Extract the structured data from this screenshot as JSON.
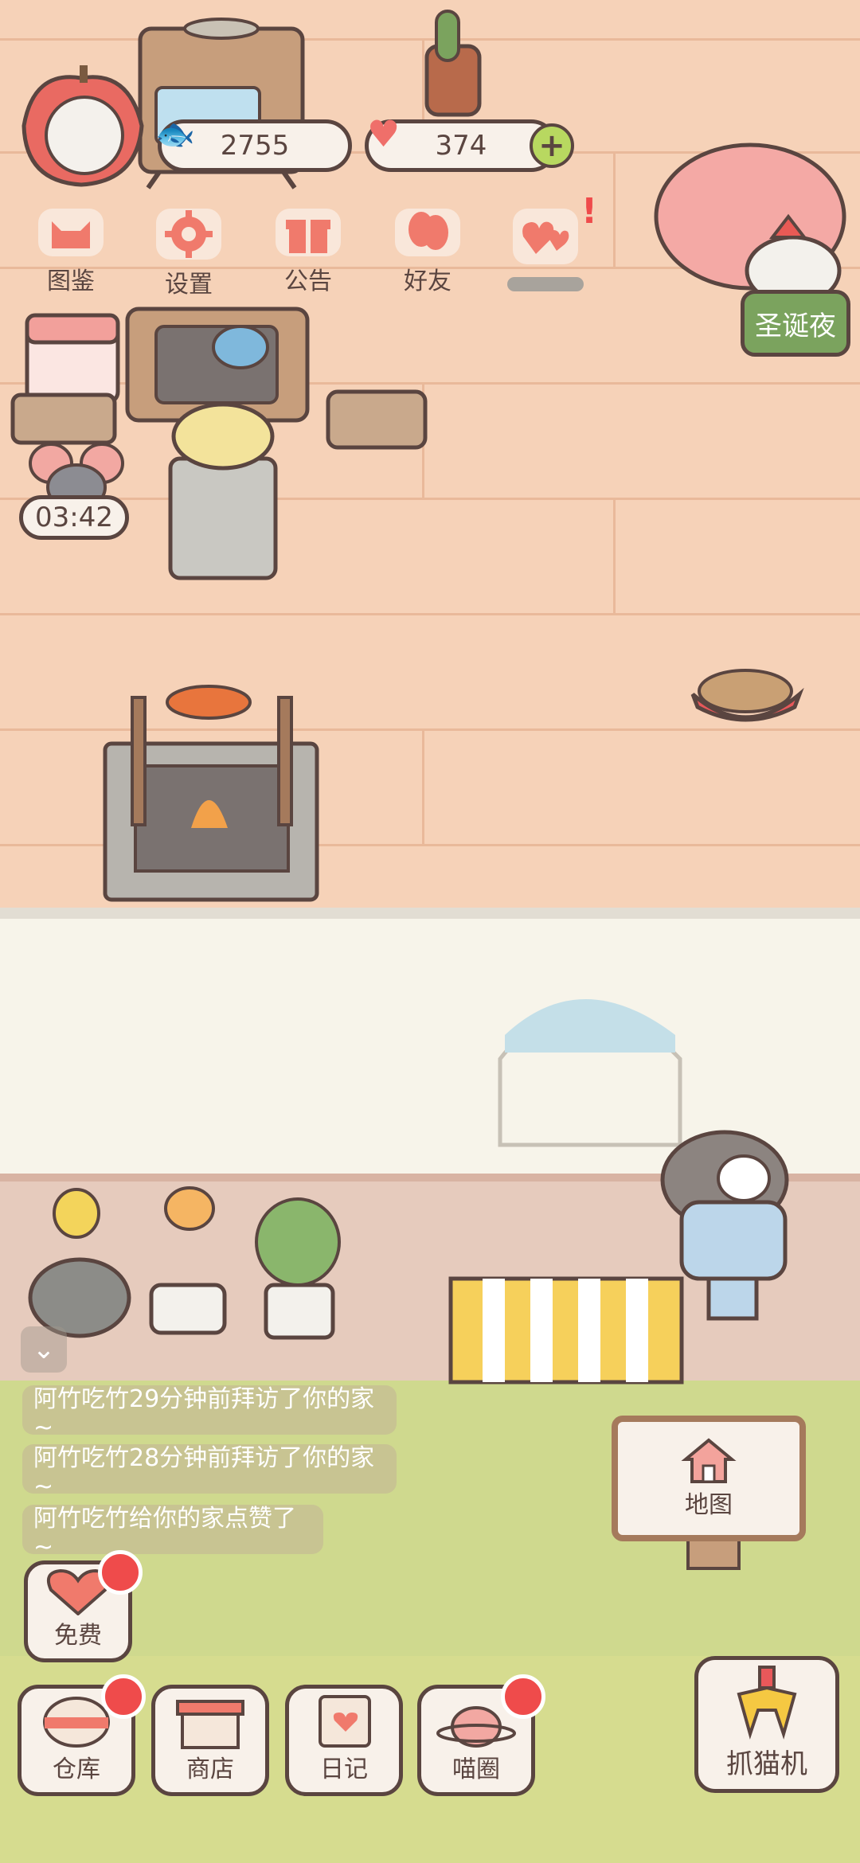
{
  "resources": {
    "fish_count": "2755",
    "heart_count": "374"
  },
  "top_menu": [
    {
      "label": "图鉴",
      "icon": "cat-head-icon"
    },
    {
      "label": "设置",
      "icon": "gear-icon"
    },
    {
      "label": "公告",
      "icon": "gift-icon"
    },
    {
      "label": "好友",
      "icon": "friends-icon"
    },
    {
      "label": "",
      "icon": "hearts-icon"
    }
  ],
  "event": {
    "label": "圣诞夜"
  },
  "timer": {
    "value": "03:42"
  },
  "notifications": [
    "阿竹吃竹29分钟前拜访了你的家~",
    "阿竹吃竹28分钟前拜访了你的家~",
    "阿竹吃竹给你的家点赞了~"
  ],
  "map_button": {
    "label": "地图"
  },
  "free_button": {
    "label": "免费"
  },
  "bottom_nav": [
    {
      "label": "仓库",
      "badge": true
    },
    {
      "label": "商店",
      "badge": false
    },
    {
      "label": "日记",
      "badge": false
    },
    {
      "label": "喵圈",
      "badge": true
    }
  ],
  "claw_button": {
    "label": "抓猫机"
  },
  "colors": {
    "floor": "#f6d2b8",
    "grass": "#cfd98e",
    "outline": "#5a4540",
    "badge_red": "#ef4b4b",
    "event_green": "#7ba35e"
  }
}
